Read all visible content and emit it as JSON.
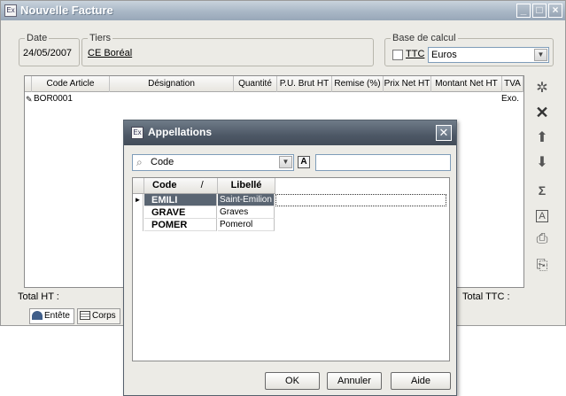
{
  "window": {
    "title": "Nouvelle Facture"
  },
  "fields": {
    "date_label": "Date",
    "date_value": "24/05/2007",
    "tiers_label": "Tiers",
    "tiers_value": "CE Boréal",
    "base_label": "Base de calcul",
    "ttc_label": "TTC",
    "currency_value": "Euros"
  },
  "grid": {
    "columns": [
      "Code Article",
      "Désignation",
      "Quantité",
      "P.U. Brut HT",
      "Remise (%)",
      "Prix Net HT",
      "Montant Net HT",
      "TVA"
    ],
    "rows": [
      {
        "code": "BOR0001",
        "tva": "Exo."
      }
    ]
  },
  "totals": {
    "ht_label": "Total HT :",
    "ttc_label": "Total TTC :"
  },
  "tabs": [
    {
      "label": "Entête"
    },
    {
      "label": "Corps"
    }
  ],
  "side_tools": [
    "gear-icon",
    "delete-icon",
    "arrow-up-icon",
    "arrow-down-icon",
    "sigma-icon",
    "text-a-icon",
    "print-icon",
    "export-icon"
  ],
  "dialog": {
    "title": "Appellations",
    "search_field": "Code",
    "search_value": "",
    "columns": {
      "code": "Code",
      "sort_indicator": "/",
      "libelle": "Libellé"
    },
    "rows": [
      {
        "code": "EMILI",
        "libelle": "Saint-Emilion",
        "selected": true
      },
      {
        "code": "GRAVE",
        "libelle": "Graves",
        "selected": false
      },
      {
        "code": "POMER",
        "libelle": "Pomerol",
        "selected": false
      }
    ],
    "buttons": {
      "ok": "OK",
      "cancel": "Annuler",
      "help": "Aide"
    }
  }
}
